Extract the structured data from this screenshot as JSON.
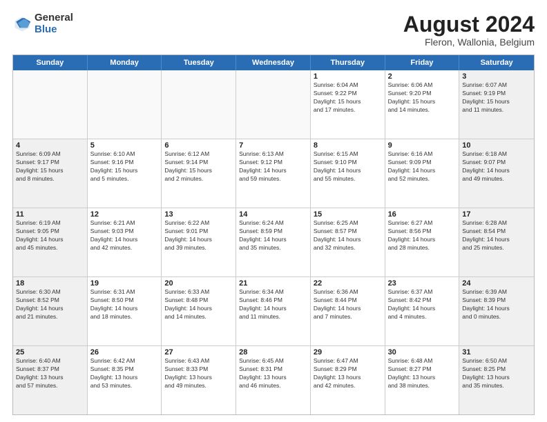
{
  "header": {
    "logo_general": "General",
    "logo_blue": "Blue",
    "month_year": "August 2024",
    "location": "Fleron, Wallonia, Belgium"
  },
  "days_of_week": [
    "Sunday",
    "Monday",
    "Tuesday",
    "Wednesday",
    "Thursday",
    "Friday",
    "Saturday"
  ],
  "weeks": [
    [
      {
        "day": "",
        "detail": ""
      },
      {
        "day": "",
        "detail": ""
      },
      {
        "day": "",
        "detail": ""
      },
      {
        "day": "",
        "detail": ""
      },
      {
        "day": "1",
        "detail": "Sunrise: 6:04 AM\nSunset: 9:22 PM\nDaylight: 15 hours\nand 17 minutes."
      },
      {
        "day": "2",
        "detail": "Sunrise: 6:06 AM\nSunset: 9:20 PM\nDaylight: 15 hours\nand 14 minutes."
      },
      {
        "day": "3",
        "detail": "Sunrise: 6:07 AM\nSunset: 9:19 PM\nDaylight: 15 hours\nand 11 minutes."
      }
    ],
    [
      {
        "day": "4",
        "detail": "Sunrise: 6:09 AM\nSunset: 9:17 PM\nDaylight: 15 hours\nand 8 minutes."
      },
      {
        "day": "5",
        "detail": "Sunrise: 6:10 AM\nSunset: 9:16 PM\nDaylight: 15 hours\nand 5 minutes."
      },
      {
        "day": "6",
        "detail": "Sunrise: 6:12 AM\nSunset: 9:14 PM\nDaylight: 15 hours\nand 2 minutes."
      },
      {
        "day": "7",
        "detail": "Sunrise: 6:13 AM\nSunset: 9:12 PM\nDaylight: 14 hours\nand 59 minutes."
      },
      {
        "day": "8",
        "detail": "Sunrise: 6:15 AM\nSunset: 9:10 PM\nDaylight: 14 hours\nand 55 minutes."
      },
      {
        "day": "9",
        "detail": "Sunrise: 6:16 AM\nSunset: 9:09 PM\nDaylight: 14 hours\nand 52 minutes."
      },
      {
        "day": "10",
        "detail": "Sunrise: 6:18 AM\nSunset: 9:07 PM\nDaylight: 14 hours\nand 49 minutes."
      }
    ],
    [
      {
        "day": "11",
        "detail": "Sunrise: 6:19 AM\nSunset: 9:05 PM\nDaylight: 14 hours\nand 45 minutes."
      },
      {
        "day": "12",
        "detail": "Sunrise: 6:21 AM\nSunset: 9:03 PM\nDaylight: 14 hours\nand 42 minutes."
      },
      {
        "day": "13",
        "detail": "Sunrise: 6:22 AM\nSunset: 9:01 PM\nDaylight: 14 hours\nand 39 minutes."
      },
      {
        "day": "14",
        "detail": "Sunrise: 6:24 AM\nSunset: 8:59 PM\nDaylight: 14 hours\nand 35 minutes."
      },
      {
        "day": "15",
        "detail": "Sunrise: 6:25 AM\nSunset: 8:57 PM\nDaylight: 14 hours\nand 32 minutes."
      },
      {
        "day": "16",
        "detail": "Sunrise: 6:27 AM\nSunset: 8:56 PM\nDaylight: 14 hours\nand 28 minutes."
      },
      {
        "day": "17",
        "detail": "Sunrise: 6:28 AM\nSunset: 8:54 PM\nDaylight: 14 hours\nand 25 minutes."
      }
    ],
    [
      {
        "day": "18",
        "detail": "Sunrise: 6:30 AM\nSunset: 8:52 PM\nDaylight: 14 hours\nand 21 minutes."
      },
      {
        "day": "19",
        "detail": "Sunrise: 6:31 AM\nSunset: 8:50 PM\nDaylight: 14 hours\nand 18 minutes."
      },
      {
        "day": "20",
        "detail": "Sunrise: 6:33 AM\nSunset: 8:48 PM\nDaylight: 14 hours\nand 14 minutes."
      },
      {
        "day": "21",
        "detail": "Sunrise: 6:34 AM\nSunset: 8:46 PM\nDaylight: 14 hours\nand 11 minutes."
      },
      {
        "day": "22",
        "detail": "Sunrise: 6:36 AM\nSunset: 8:44 PM\nDaylight: 14 hours\nand 7 minutes."
      },
      {
        "day": "23",
        "detail": "Sunrise: 6:37 AM\nSunset: 8:42 PM\nDaylight: 14 hours\nand 4 minutes."
      },
      {
        "day": "24",
        "detail": "Sunrise: 6:39 AM\nSunset: 8:39 PM\nDaylight: 14 hours\nand 0 minutes."
      }
    ],
    [
      {
        "day": "25",
        "detail": "Sunrise: 6:40 AM\nSunset: 8:37 PM\nDaylight: 13 hours\nand 57 minutes."
      },
      {
        "day": "26",
        "detail": "Sunrise: 6:42 AM\nSunset: 8:35 PM\nDaylight: 13 hours\nand 53 minutes."
      },
      {
        "day": "27",
        "detail": "Sunrise: 6:43 AM\nSunset: 8:33 PM\nDaylight: 13 hours\nand 49 minutes."
      },
      {
        "day": "28",
        "detail": "Sunrise: 6:45 AM\nSunset: 8:31 PM\nDaylight: 13 hours\nand 46 minutes."
      },
      {
        "day": "29",
        "detail": "Sunrise: 6:47 AM\nSunset: 8:29 PM\nDaylight: 13 hours\nand 42 minutes."
      },
      {
        "day": "30",
        "detail": "Sunrise: 6:48 AM\nSunset: 8:27 PM\nDaylight: 13 hours\nand 38 minutes."
      },
      {
        "day": "31",
        "detail": "Sunrise: 6:50 AM\nSunset: 8:25 PM\nDaylight: 13 hours\nand 35 minutes."
      }
    ]
  ]
}
